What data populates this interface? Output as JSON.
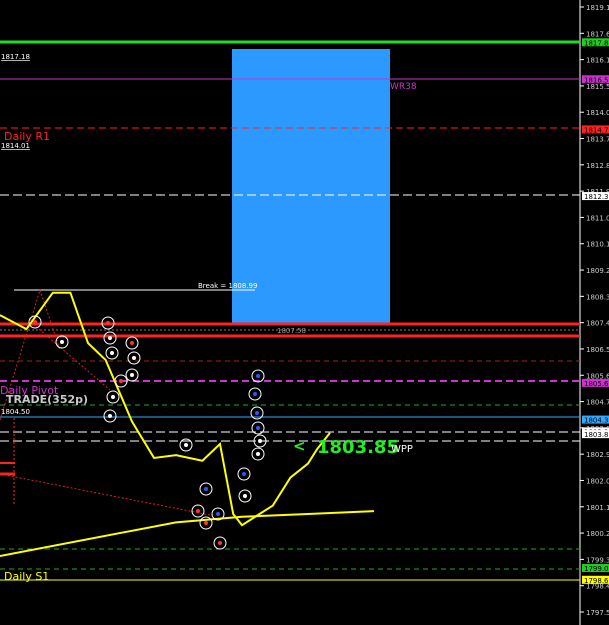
{
  "chart_data": {
    "type": "line",
    "instrument_view": "trading-chart",
    "y_ticks": [
      "1819.10",
      "1817.60",
      "1816.10",
      "1815.50",
      "1814.00",
      "1813.70",
      "1812.80",
      "1811.90",
      "1811.00",
      "1810.10",
      "1809.20",
      "1808.30",
      "1807.40",
      "1806.50",
      "1805.60",
      "1804.70",
      "1803.80",
      "1802.90",
      "1802.00",
      "1801.10",
      "1800.20",
      "1799.30",
      "1798.40",
      "1797.50"
    ],
    "ylim": [
      1797.5,
      1819.1
    ],
    "price_tags": [
      {
        "label": "1817.84",
        "price": 1817.84,
        "color": "#22cc22"
      },
      {
        "label": "1816.52",
        "price": 1816.52,
        "color": "#cc33cc"
      },
      {
        "label": "1814.73",
        "price": 1814.73,
        "color": "#ff2222"
      },
      {
        "label": "1812.35",
        "price": 1812.35,
        "color": "#ffffff"
      },
      {
        "label": "1805.68",
        "price": 1805.68,
        "color": "#cc33cc"
      },
      {
        "label": "1804.37",
        "price": 1804.37,
        "color": "#33aaff"
      },
      {
        "label": "1803.95",
        "price": 1803.95,
        "color": "#ffffff"
      },
      {
        "label": "1803.85",
        "price": 1803.85,
        "color": "#ffffff"
      },
      {
        "label": "1799.07",
        "price": 1799.07,
        "color": "#22cc22"
      },
      {
        "label": "1798.65",
        "price": 1798.65,
        "color": "#ffff00"
      }
    ],
    "levels": [
      {
        "label": "1817.18",
        "price": 1817.18,
        "color": "#ffffff",
        "style": "none"
      },
      {
        "label": "WR38",
        "price": 1816.52,
        "color": "#cc33cc",
        "style": "solid"
      },
      {
        "label": "Daily R1",
        "price": 1814.73,
        "color": "#ff2222",
        "style": "dashed"
      },
      {
        "label": "1814.01",
        "price": 1814.01,
        "color": "#ffffff",
        "style": "none"
      },
      {
        "label": "Break = 1808.99",
        "price": 1808.99,
        "color": "#ffffff",
        "style": "solid"
      },
      {
        "label": "1807.58",
        "price": 1807.58,
        "color": "#888888",
        "style": "none"
      },
      {
        "label": "Daily Pivot",
        "price": 1805.68,
        "color": "#cc33cc",
        "style": "dashed"
      },
      {
        "label": "TRADE(352p)",
        "price": 1805.1,
        "color": "#d0d0d0",
        "style": "none"
      },
      {
        "label": "1804.50",
        "price": 1804.5,
        "color": "#ffffff",
        "style": "none"
      },
      {
        "label": "Daily S1",
        "price": 1798.65,
        "color": "#ffff00",
        "style": "solid"
      }
    ],
    "current_price": {
      "label": "1803.85",
      "suffix": "WPP",
      "arrow": "<",
      "price": 1803.85,
      "color": "#22ee22"
    },
    "box": {
      "price_top": 1817.84,
      "price_bottom": 1807.85,
      "color": "#2b99ff"
    },
    "series": [
      {
        "x": [
          0,
          6,
          12,
          16,
          20,
          24,
          30,
          35,
          40,
          46,
          50,
          53,
          55,
          58,
          62,
          66,
          70,
          72,
          75
        ],
        "y": [
          1808.1,
          1807.6,
          1808.9,
          1808.9,
          1807.1,
          1806.5,
          1804.3,
          1803.0,
          1803.1,
          1802.9,
          1803.5,
          1801.0,
          1800.6,
          1800.9,
          1801.3,
          1802.3,
          1802.8,
          1803.3,
          1803.9
        ],
        "color": "#ffff00"
      },
      {
        "x": [
          0,
          40,
          55,
          70,
          85
        ],
        "y": [
          1799.5,
          1800.7,
          1800.9,
          1801.0,
          1801.1
        ],
        "color": "#ffff00"
      }
    ]
  }
}
